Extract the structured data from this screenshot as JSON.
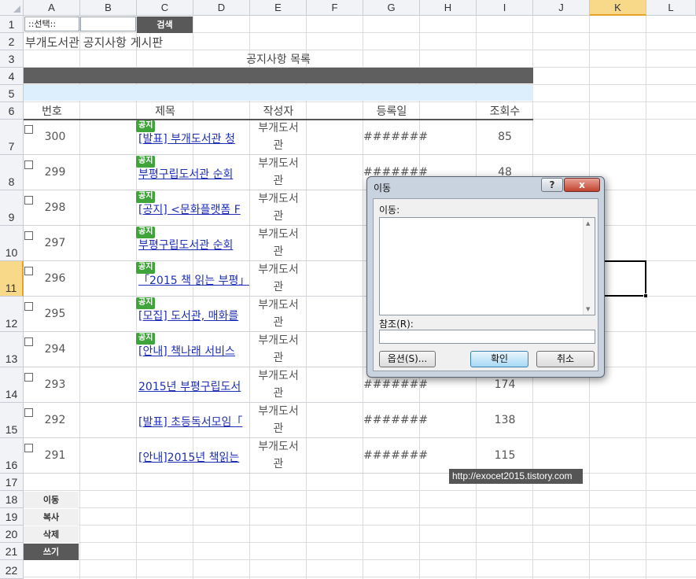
{
  "columns": [
    "A",
    "B",
    "C",
    "D",
    "E",
    "F",
    "G",
    "H",
    "I",
    "J",
    "K",
    "L"
  ],
  "rows": [
    "1",
    "2",
    "3",
    "4",
    "5",
    "6",
    "7",
    "8",
    "9",
    "10",
    "11",
    "12",
    "13",
    "14",
    "15",
    "16",
    "17",
    "18",
    "19",
    "20",
    "21",
    "22"
  ],
  "sheet": {
    "select_label": "::선택::",
    "search_label": "검색",
    "board_title": "부개도서관 공지사항 게시판",
    "list_title": "공지사항 목록",
    "headers": {
      "no": "번호",
      "title": "제목",
      "author": "작성자",
      "date": "등록일",
      "views": "조회수"
    },
    "posts": [
      {
        "no": "300",
        "badge": "공지",
        "title": "[발표] 부개도서관 청",
        "author1": "부개도서",
        "author2": "관",
        "date": "#######",
        "views": "85"
      },
      {
        "no": "299",
        "badge": "공지",
        "title": "부평구립도서관 순회",
        "author1": "부개도서",
        "author2": "관",
        "date": "#######",
        "views": "48"
      },
      {
        "no": "298",
        "badge": "공지",
        "title": "[공지] <문화플랫폼 F",
        "author1": "부개도서",
        "author2": "관",
        "date": "",
        "views": ""
      },
      {
        "no": "297",
        "badge": "공지",
        "title": "부평구립도서관 순회",
        "author1": "부개도서",
        "author2": "관",
        "date": "",
        "views": ""
      },
      {
        "no": "296",
        "badge": "공지",
        "title": "「2015 책 읽는 부평」",
        "author1": "부개도서",
        "author2": "관",
        "date": "",
        "views": ""
      },
      {
        "no": "295",
        "badge": "공지",
        "title": "[모집] 도서관, 매화를",
        "author1": "부개도서",
        "author2": "관",
        "date": "",
        "views": ""
      },
      {
        "no": "294",
        "badge": "공지",
        "title": "[안내] 책나래 서비스",
        "author1": "부개도서",
        "author2": "관",
        "date": "",
        "views": ""
      },
      {
        "no": "293",
        "badge": "",
        "title": "2015년 부평구립도서",
        "author1": "부개도서",
        "author2": "관",
        "date": "#######",
        "views": "174"
      },
      {
        "no": "292",
        "badge": "",
        "title": "[발표] 초등독서모임「",
        "author1": "부개도서",
        "author2": "관",
        "date": "#######",
        "views": "138"
      },
      {
        "no": "291",
        "badge": "",
        "title": "[안내]2015년 책읽는",
        "author1": "부개도서",
        "author2": "관",
        "date": "#######",
        "views": "115"
      }
    ],
    "menu": [
      "이동",
      "복사",
      "삭제",
      "쓰기"
    ],
    "url_label": "http://exocet2015.tistory.com"
  },
  "dialog": {
    "title": "이동",
    "help": "?",
    "close": "x",
    "goto_label": "이동:",
    "ref_label": "참조(R):",
    "options_btn": "옵션(S)...",
    "ok_btn": "확인",
    "cancel_btn": "취소"
  }
}
